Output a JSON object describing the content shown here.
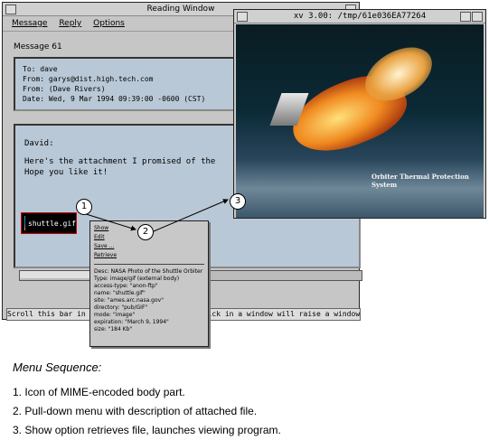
{
  "reading_window": {
    "title": "Reading Window",
    "menus": [
      "Message",
      "Reply",
      "Options"
    ],
    "message_label": "Message 61",
    "header_lines": [
      "To: dave",
      "From: garys@dist.high.tech.com",
      "From: (Dave Rivers)",
      "Date: Wed, 9 Mar 1994 09:39:00 -0600 (CST)"
    ],
    "body_greeting": "David:",
    "body_lines": [
      "Here's the attachment I promised of the",
      "Hope you like it!"
    ],
    "attachment_label": "shuttle.gif",
    "status_text": "Scroll this bar in this window to see more. Click in a window will raise a window"
  },
  "popup_menu": {
    "items": [
      "Show",
      "Edit",
      "Save ...",
      "Retrieve"
    ],
    "description_lines": [
      "Desc: NASA Photo of the Shuttle Orbiter",
      "Type: image/gif (external body)",
      "access-type: \"anon-ftp\"",
      "name: \"shuttle.gif\"",
      "site: \"ames.arc.nasa.gov\"",
      "directory: \"pub/GIF\"",
      "mode: \"image\"",
      "expiration: \"March 9, 1994\"",
      "size: \"184 Kb\""
    ]
  },
  "xv_window": {
    "title": "xv 3.00: /tmp/61e036EA77264",
    "image_caption": "Orbiter Thermal Protection System"
  },
  "callouts": [
    "1",
    "2",
    "3"
  ],
  "sequence": {
    "title": "Menu Sequence:",
    "steps": [
      "1. Icon of MIME-encoded body part.",
      "2. Pull-down menu with description of attached file.",
      "3. Show option retrieves file, launches viewing program."
    ]
  }
}
